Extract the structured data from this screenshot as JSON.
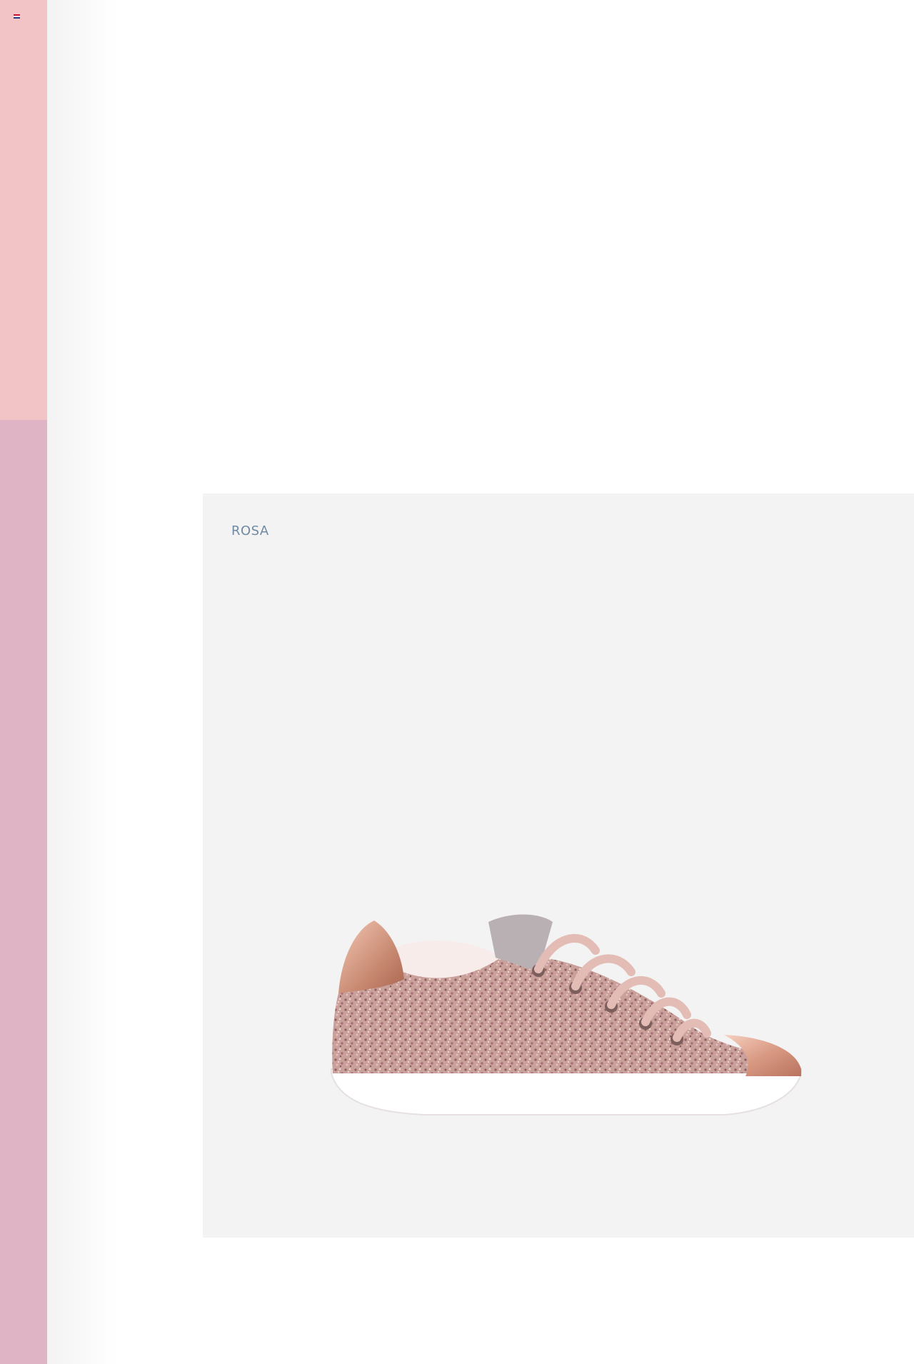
{
  "colors": {
    "sidebar_top": "#f2c4c5",
    "sidebar_bottom": "#dfb5c5",
    "card_background": "#f3f3f3",
    "label_color": "#6f8aa3"
  },
  "sidebar": {
    "language_icon": "flag-icon"
  },
  "product": {
    "color_label": "ROSA",
    "image_icon": "glitter-sneaker-image"
  }
}
